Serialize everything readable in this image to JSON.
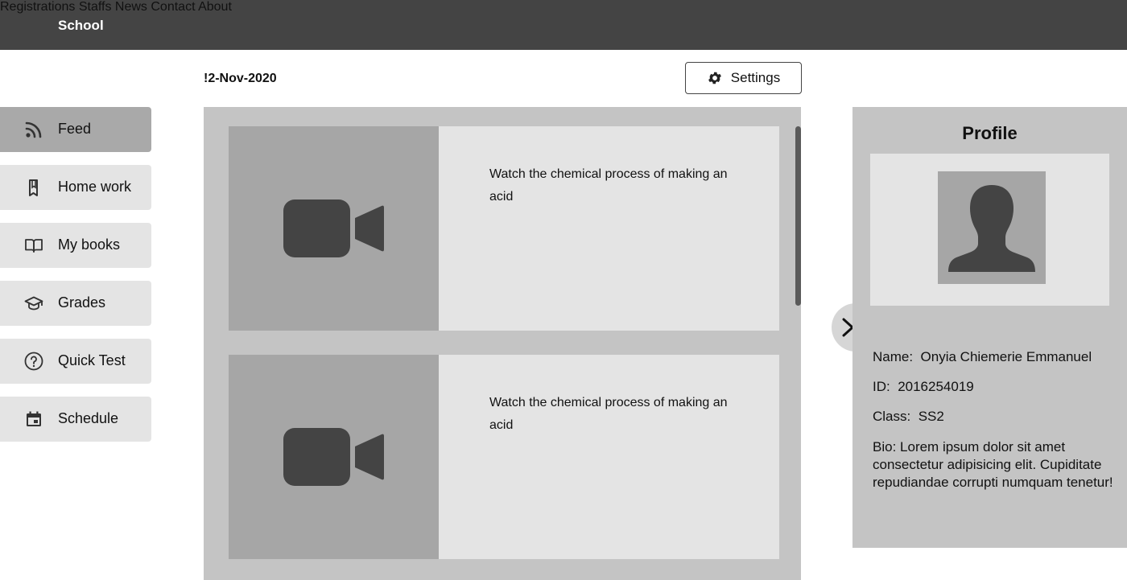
{
  "app": {
    "brand": "School",
    "nav": [
      "Registrations",
      "Staffs",
      "News",
      "Contact",
      "About"
    ]
  },
  "header": {
    "date": "!2-Nov-2020",
    "settings_label": "Settings"
  },
  "sidebar": {
    "items": [
      {
        "label": "Feed",
        "icon": "rss-icon",
        "active": true
      },
      {
        "label": "Home work",
        "icon": "bookmark-icon",
        "active": false
      },
      {
        "label": "My books",
        "icon": "book-icon",
        "active": false
      },
      {
        "label": "Grades",
        "icon": "graduation-cap-icon",
        "active": false
      },
      {
        "label": "Quick Test",
        "icon": "question-icon",
        "active": false
      },
      {
        "label": "Schedule",
        "icon": "calendar-icon",
        "active": false
      }
    ]
  },
  "feed": {
    "items": [
      {
        "text": "Watch the chemical process of making an acid",
        "media": "video-icon"
      },
      {
        "text": "Watch the chemical process of making an acid",
        "media": "video-icon"
      }
    ]
  },
  "profile": {
    "title": "Profile",
    "name_label": "Name:",
    "name": "Onyia Chiemerie Emmanuel",
    "id_label": "ID:",
    "id": "2016254019",
    "class_label": "Class:",
    "class": "SS2",
    "bio_label": "Bio:",
    "bio": "Lorem ipsum dolor sit amet consectetur adipisicing elit. Cupiditate repudiandae corrupti numquam tenetur!"
  },
  "colors": {
    "topbar": "#444444",
    "panel": "#c4c4c4",
    "card": "#e4e4e4",
    "thumb": "#a6a6a6",
    "active_item": "#a9a9a9"
  }
}
